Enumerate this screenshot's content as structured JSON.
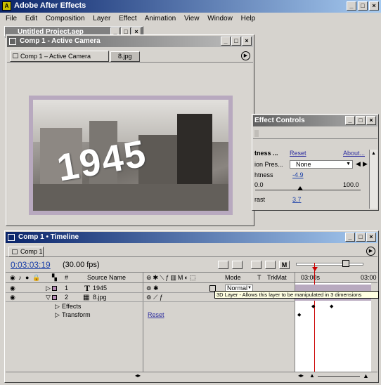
{
  "app": {
    "title": "Adobe After Effects"
  },
  "menu": [
    "File",
    "Edit",
    "Composition",
    "Layer",
    "Effect",
    "Animation",
    "View",
    "Window",
    "Help"
  ],
  "project_window": {
    "title": "Untitled Project.aep"
  },
  "comp_window": {
    "title": "Comp 1 - Active Camera",
    "tabs": [
      "Comp 1 – Active Camera",
      "8.jpg"
    ],
    "text_1945": "1945"
  },
  "effect_controls": {
    "title": "Effect Controls",
    "rows": [
      {
        "label": "tness ...",
        "value": "Reset",
        "extra": "About..."
      },
      {
        "label": "ion Pres...",
        "value": "None",
        "extra": ""
      },
      {
        "label": "htness",
        "value": "-4.9",
        "extra": ""
      },
      {
        "label": "0.0",
        "value": "",
        "extra": "100.0"
      },
      {
        "label": "rast",
        "value": "3.7",
        "extra": ""
      }
    ]
  },
  "timeline": {
    "title": "Comp 1 • Timeline",
    "tab": "Comp 1",
    "timecode": "0:03:03:19",
    "fps": "(30.00 fps)",
    "col_source_name": "Source Name",
    "col_hash": "#",
    "col_mode": "Mode",
    "col_t": "T",
    "col_trkmat": "TrkMat",
    "ruler_start": "03:00s",
    "ruler_end": "03:00",
    "layers": [
      {
        "num": "1",
        "name": "1945",
        "mode": "Normal",
        "type": "text"
      },
      {
        "num": "2",
        "name": "8.jpg",
        "mode": "",
        "type": "image"
      }
    ],
    "sub_effects": "Effects",
    "sub_transform": "Transform",
    "reset_label": "Reset",
    "tooltip": "3D Layer - Allows this layer to be manipulated in 3 dimensions"
  },
  "colors": {
    "title_active": "#0a246a",
    "title_inactive": "#808080",
    "link": "#1a3fa8",
    "current_time_marker": "#cc0000"
  }
}
